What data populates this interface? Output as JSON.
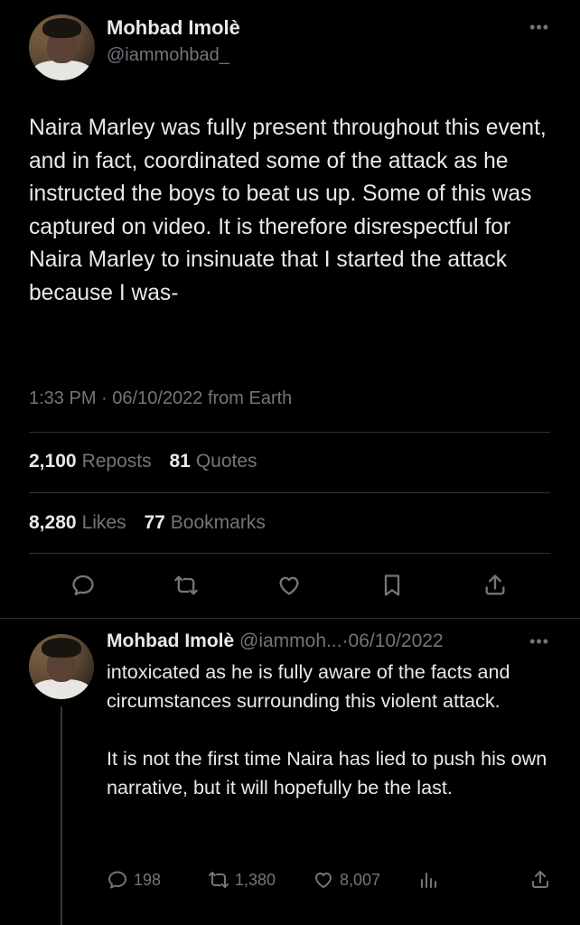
{
  "tweet": {
    "author_name": "Mohbad Imolè",
    "author_handle": "@iammohbad_",
    "more_icon": "more-horizontal-icon",
    "text": "Naira Marley was fully present throughout this event, and in fact, coordinated some of the attack as he instructed the boys to beat us up. Some of this was captured on video.  It is therefore disrespectful for Naira Marley to insinuate that I started the attack because I was-",
    "time": "1:33 PM",
    "date": "06/10/2022",
    "source": "from Earth",
    "reposts_count": "2,100",
    "reposts_label": "Reposts",
    "quotes_count": "81",
    "quotes_label": "Quotes",
    "likes_count": "8,280",
    "likes_label": "Likes",
    "bookmarks_count": "77",
    "bookmarks_label": "Bookmarks",
    "actions": [
      "reply-icon",
      "repost-icon",
      "like-icon",
      "bookmark-icon",
      "share-icon"
    ]
  },
  "reply": {
    "author_name": "Mohbad Imolè",
    "author_handle": "@iammoh...",
    "date": "06/10/2022",
    "text_p1": "intoxicated as he is fully aware of the facts and circumstances surrounding this violent attack.",
    "text_p2": "It is not the first time Naira has lied to push his own narrative, but it will hopefully be the last.",
    "reply_count": "198",
    "repost_count": "1,380",
    "like_count": "8,007"
  },
  "colors": {
    "background": "#000000",
    "text": "#e7e9ea",
    "muted": "#71767b",
    "divider": "#2f3336"
  }
}
